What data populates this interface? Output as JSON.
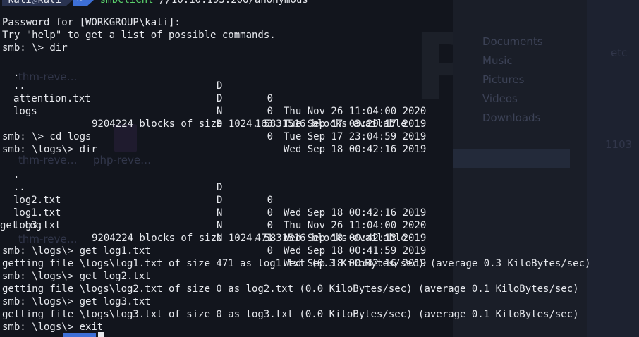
{
  "prompt": {
    "user": "kali",
    "at": "@",
    "host": "kali",
    "dir": "~",
    "command": "smbclient",
    "argument": "//10.10.195.206/anonymous"
  },
  "lines": {
    "password": "Password for [WORKGROUP\\kali]:",
    "help": "Try \"help\" to get a list of possible commands.",
    "cmd_dir": "smb: \\> dir",
    "blocks1": "9204224 blocks of size 1024. 5831516 blocks available",
    "cmd_cd": "smb: \\> cd logs",
    "cmd_dir2": "smb: \\logs\\> dir",
    "get_log": "get log",
    "blocks2": "9204224 blocks of size 1024. 5831516 blocks available",
    "cmd_get1": "smb: \\logs\\> get log1.txt",
    "res_get1": "getting file \\logs\\log1.txt of size 471 as log1.txt (0.3 KiloBytes/sec) (average 0.3 KiloBytes/sec)",
    "cmd_get2": "smb: \\logs\\> get log2.txt",
    "res_get2": "getting file \\logs\\log2.txt of size 0 as log2.txt (0.0 KiloBytes/sec) (average 0.1 KiloBytes/sec)",
    "cmd_get3": "smb: \\logs\\> get log3.txt",
    "res_get3": "getting file \\logs\\log3.txt of size 0 as log3.txt (0.0 KiloBytes/sec) (average 0.1 KiloBytes/sec)",
    "cmd_exit": "smb: \\logs\\> exit"
  },
  "listing1": [
    {
      "name": ".",
      "type": "D",
      "size": "0",
      "date": "Thu Nov 26 11:04:00 2020"
    },
    {
      "name": "..",
      "type": "D",
      "size": "0",
      "date": "Tue Sep 17 03:20:17 2019"
    },
    {
      "name": "attention.txt",
      "type": "N",
      "size": "163",
      "date": "Tue Sep 17 23:04:59 2019"
    },
    {
      "name": "logs",
      "type": "D",
      "size": "0",
      "date": "Wed Sep 18 00:42:16 2019"
    }
  ],
  "listing2": [
    {
      "name": ".",
      "type": "D",
      "size": "0",
      "date": "Wed Sep 18 00:42:16 2019"
    },
    {
      "name": "..",
      "type": "D",
      "size": "0",
      "date": "Thu Nov 26 11:04:00 2020"
    },
    {
      "name": "log2.txt",
      "type": "N",
      "size": "0",
      "date": "Wed Sep 18 00:42:13 2019"
    },
    {
      "name": "log1.txt",
      "type": "N",
      "size": "471",
      "date": "Wed Sep 18 00:41:59 2019"
    },
    {
      "name": "log3.txt",
      "type": "N",
      "size": "0",
      "date": "Wed Sep 18 00:42:16 2019"
    }
  ],
  "background": {
    "fm_items": [
      "Documents",
      "Music",
      "Pictures",
      "Videos",
      "Downloads"
    ],
    "thumb1": "thm-reve…",
    "thumb2": "thm-reve…",
    "thumb3": "php-reve…",
    "thumb4": "thm-reve…",
    "etc": "etc",
    "side_num": "1103"
  },
  "colors": {
    "background": "#12151d",
    "text": "#e7e9ee",
    "command": "#5ad06c",
    "prompt_blue": "#3d6fd6"
  }
}
